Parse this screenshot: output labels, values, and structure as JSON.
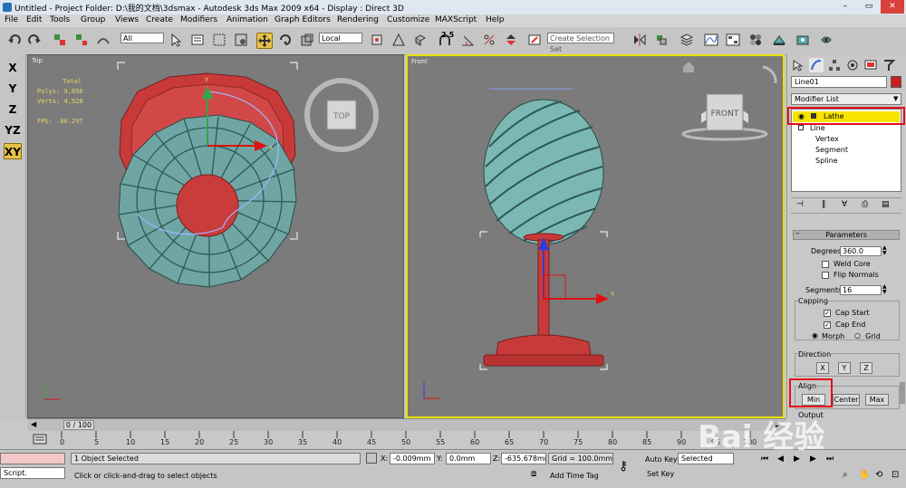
{
  "window": {
    "title": "Untitled      - Project Folder: D:\\我的文档\\3dsmax      - Autodesk 3ds Max  2009 x64      - Display : Direct 3D",
    "min": "–",
    "max": "▭",
    "close": "✕"
  },
  "menu": [
    "File",
    "Edit",
    "Tools",
    "Group",
    "Views",
    "Create",
    "Modifiers",
    "Animation",
    "Graph Editors",
    "Rendering",
    "Customize",
    "MAXScript",
    "Help"
  ],
  "toolbar": {
    "filter_value": "All",
    "coord_value": "Local",
    "selection_set_placeholder": "Create Selection Set",
    "snap_label": "2.5"
  },
  "axis_buttons": [
    "X",
    "Y",
    "Z",
    "YZ",
    "XY"
  ],
  "viewports": {
    "top": {
      "label": "Top",
      "stats_title": "Total",
      "polys": "Polys: 9,056",
      "verts": "Verts: 4,528",
      "fps": "FPS:  80.297",
      "viewcube_label": "TOP"
    },
    "front": {
      "label": "Front",
      "viewcube_label": "FRONT"
    }
  },
  "command_panel": {
    "object_name": "Line01",
    "modifier_list_label": "Modifier List",
    "stack": {
      "lathe": "Lathe",
      "line": "Line",
      "vertex": "Vertex",
      "segment": "Segment",
      "spline": "Spline"
    },
    "parameters": {
      "header": "Parameters",
      "degrees_label": "Degrees:",
      "degrees_value": "360.0",
      "weld_core": "Weld Core",
      "flip_normals": "Flip Normals",
      "segments_label": "Segments:",
      "segments_value": "16",
      "capping": "Capping",
      "cap_start": "Cap Start",
      "cap_end": "Cap End",
      "morph": "Morph",
      "grid": "Grid",
      "direction": "Direction",
      "dir_x": "X",
      "dir_y": "Y",
      "dir_z": "Z",
      "align": "Align",
      "align_min": "Min",
      "align_center": "Center",
      "align_max": "Max",
      "output_partial": "Output"
    }
  },
  "timeline": {
    "frame_display": "0 / 100",
    "ticks": [
      "0",
      "5",
      "10",
      "15",
      "20",
      "25",
      "30",
      "35",
      "40",
      "45",
      "50",
      "55",
      "60",
      "65",
      "70",
      "75",
      "80",
      "85",
      "90",
      "95",
      "100"
    ]
  },
  "status": {
    "objects_selected": "1 Object Selected",
    "prompt": "Click or click-and-drag to select objects",
    "script_label": "Script.",
    "x_label": "X:",
    "x_value": "-0.009mm",
    "y_label": "Y:",
    "y_value": "0.0mm",
    "z_label": "Z:",
    "z_value": "-635.678mm",
    "grid": "Grid = 100.0mm",
    "add_time_tag": "Add Time Tag",
    "auto_key": "Auto Key",
    "set_key": "Set Key",
    "key_mode": "Selected"
  },
  "watermark": "Bai 经验"
}
